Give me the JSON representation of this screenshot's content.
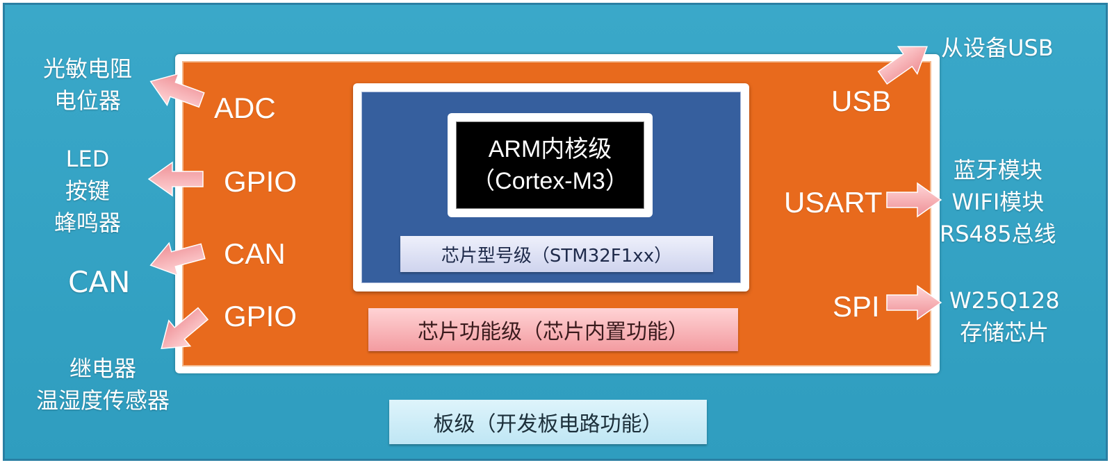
{
  "levels": {
    "arm_line1": "ARM内核级",
    "arm_line2": "（Cortex-M3）",
    "model": "芯片型号级（STM32F1xx）",
    "function": "芯片功能级（芯片内置功能）",
    "board": "板级（开发板电路功能）"
  },
  "peripherals_left": [
    "ADC",
    "GPIO",
    "CAN",
    "GPIO"
  ],
  "peripherals_right": [
    "USB",
    "USART",
    "SPI"
  ],
  "devices_left": {
    "adc": [
      "光敏电阻",
      "电位器"
    ],
    "gpio1": [
      "LED",
      "按键",
      "蜂鸣器"
    ],
    "can": [
      "CAN"
    ],
    "gpio2": [
      "继电器",
      "温湿度传感器"
    ]
  },
  "devices_right": {
    "usb": [
      "从设备USB"
    ],
    "usart": [
      "蓝牙模块",
      "WIFI模块",
      "RS485总线"
    ],
    "spi": [
      "W25Q128",
      "存储芯片"
    ]
  },
  "colors": {
    "board": "#2f9dbf",
    "chip_function": "#e86a1d",
    "chip_model": "#365f9e",
    "arm_core": "#000000",
    "arrow": "#f4a0a5"
  }
}
